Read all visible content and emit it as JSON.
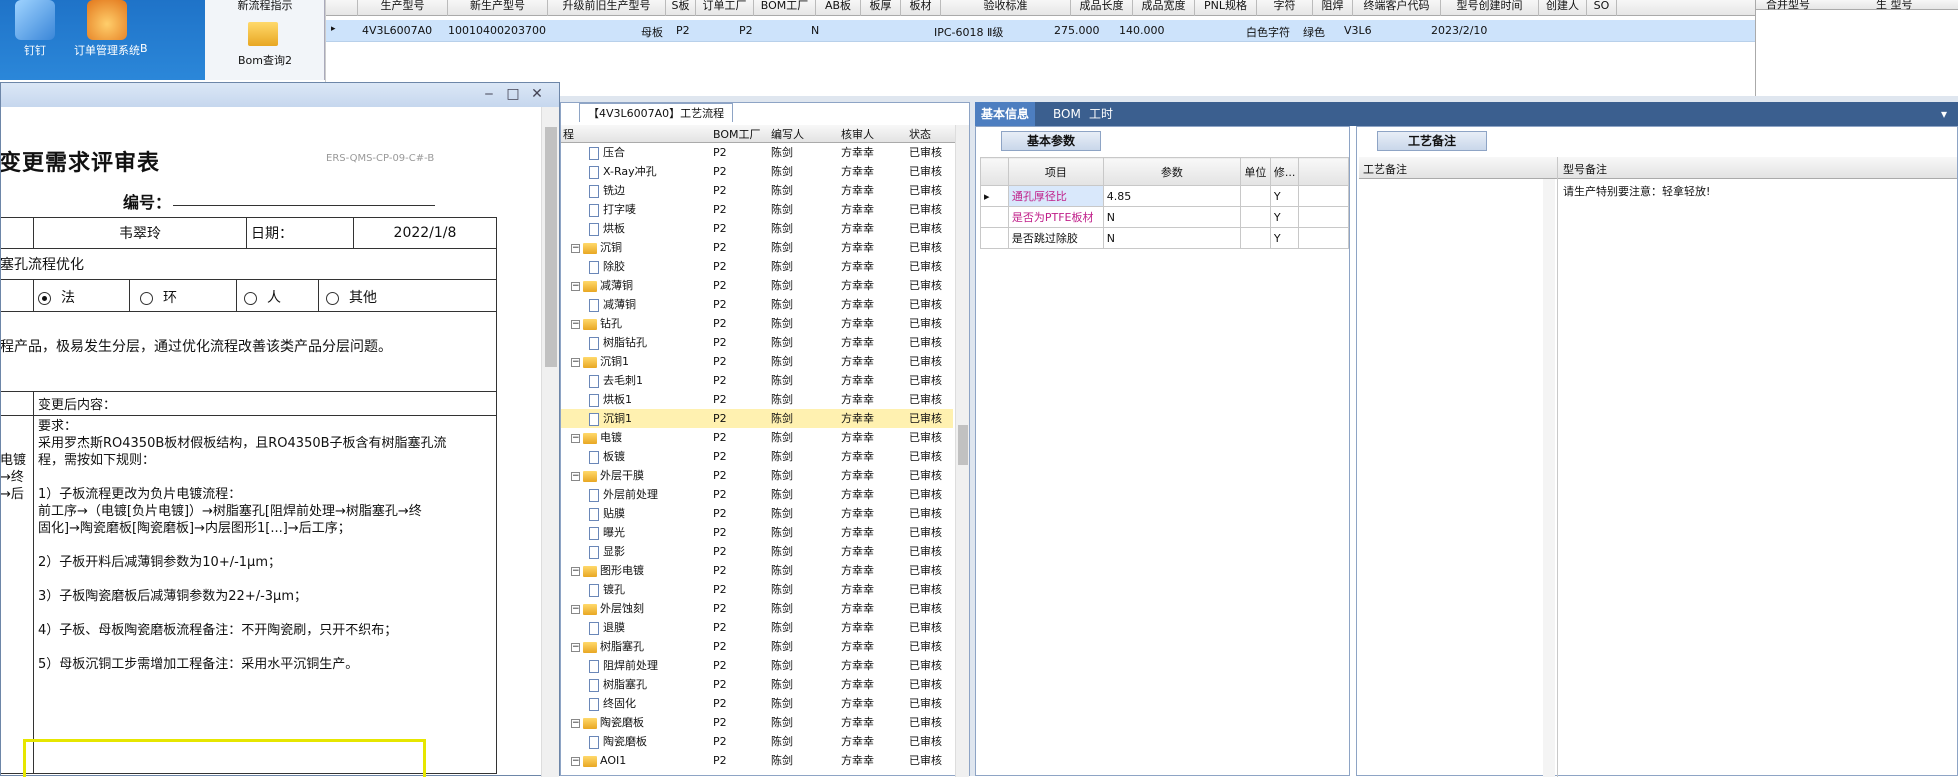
{
  "desktop": {
    "icon1_label": "钉钉",
    "icon2_label": "订单管理系统",
    "icon3_letter": "B"
  },
  "nav": {
    "item1": "新流程指示",
    "item2": "Bom查询2"
  },
  "top_grid": {
    "columns": [
      "生产型号",
      "新生产型号",
      "升级前旧生产型号",
      "S板",
      "订单工厂",
      "BOM工厂",
      "AB板",
      "板厚",
      "板材",
      "验收标准",
      "成品长度",
      "成品宽度",
      "PNL规格",
      "字符",
      "阻焊",
      "终端客户代码",
      "型号创建时间",
      "创建人",
      "SO"
    ],
    "row": {
      "model": "4V3L6007A0",
      "new_model": "10010400203700",
      "s_board": "母板",
      "order_factory": "P2",
      "bom_factory": "P2",
      "ab": "N",
      "accept": "IPC-6018 Ⅱ级",
      "length": "275.000",
      "width": "140.000",
      "char": "白色字符",
      "mask": "绿色",
      "customer": "V3L6",
      "created": "2023/2/10"
    }
  },
  "right_panel": {
    "col1": "合并型号",
    "col2": "生 型号"
  },
  "doc": {
    "title": "变更需求评审表",
    "code": "ERS-QMS-CP-09-C#-B",
    "num_label": "编号：",
    "applicant": "韦翠玲",
    "date_label": "日期：",
    "date_value": "2022/1/8",
    "subject": "塞孔流程优化",
    "opt1": "法",
    "opt2": "环",
    "opt3": "人",
    "opt4": "其他",
    "problem": "程产品，极易发生分层，通过优化流程改善该类产品分层问题。",
    "after_label": "变更后内容：",
    "req_label": "要求：",
    "line1": "采用罗杰斯RO4350B板材假板结构，且RO4350B子板含有树脂塞孔流",
    "line2": "程，需按如下规则：",
    "left_frag1": "电镀",
    "left_frag2": "→终",
    "left_frag3": "→后",
    "rule1a": "1）子板流程更改为负片电镀流程：",
    "rule1b": "前工序→（电镀[负片电镀]）→树脂塞孔[阻焊前处理→树脂塞孔→终",
    "rule1c": "固化]→陶瓷磨板[陶瓷磨板]→内层图形1[...]→后工序；",
    "rule2": "2）子板开料后减薄铜参数为10+/-1μm；",
    "rule3": "3）子板陶瓷磨板后减薄铜参数为22+/-3μm；",
    "rule4": "4）子板、母板陶瓷磨板流程备注：不开陶瓷刷，只开不织布；",
    "rule5": "5）母板沉铜工步需增加工程备注：采用水平沉铜生产。"
  },
  "process": {
    "tab": "【4V3L6007A0】工艺流程",
    "headers": [
      "程",
      "BOM工厂",
      "编写人",
      "核审人",
      "状态"
    ],
    "rows": [
      {
        "name": "压合",
        "lvl": 1,
        "folder": false
      },
      {
        "name": "X-Ray冲孔",
        "lvl": 1,
        "folder": false
      },
      {
        "name": "铣边",
        "lvl": 1,
        "folder": false
      },
      {
        "name": "打字唛",
        "lvl": 1,
        "folder": false
      },
      {
        "name": "烘板",
        "lvl": 1,
        "folder": false
      },
      {
        "name": "沉铜",
        "lvl": 0,
        "folder": true
      },
      {
        "name": "除胶",
        "lvl": 1,
        "folder": false
      },
      {
        "name": "减薄铜",
        "lvl": 0,
        "folder": true
      },
      {
        "name": "减薄铜",
        "lvl": 1,
        "folder": false
      },
      {
        "name": "钻孔",
        "lvl": 0,
        "folder": true
      },
      {
        "name": "树脂钻孔",
        "lvl": 1,
        "folder": false
      },
      {
        "name": "沉铜1",
        "lvl": 0,
        "folder": true
      },
      {
        "name": "去毛刺1",
        "lvl": 1,
        "folder": false
      },
      {
        "name": "烘板1",
        "lvl": 1,
        "folder": false
      },
      {
        "name": "沉铜1",
        "lvl": 1,
        "folder": false,
        "selected": true
      },
      {
        "name": "电镀",
        "lvl": 0,
        "folder": true
      },
      {
        "name": "板镀",
        "lvl": 1,
        "folder": false
      },
      {
        "name": "外层干膜",
        "lvl": 0,
        "folder": true
      },
      {
        "name": "外层前处理",
        "lvl": 1,
        "folder": false
      },
      {
        "name": "贴膜",
        "lvl": 1,
        "folder": false
      },
      {
        "name": "曝光",
        "lvl": 1,
        "folder": false
      },
      {
        "name": "显影",
        "lvl": 1,
        "folder": false
      },
      {
        "name": "图形电镀",
        "lvl": 0,
        "folder": true
      },
      {
        "name": "镀孔",
        "lvl": 1,
        "folder": false
      },
      {
        "name": "外层蚀刻",
        "lvl": 0,
        "folder": true
      },
      {
        "name": "退膜",
        "lvl": 1,
        "folder": false
      },
      {
        "name": "树脂塞孔",
        "lvl": 0,
        "folder": true
      },
      {
        "name": "阻焊前处理",
        "lvl": 1,
        "folder": false
      },
      {
        "name": "树脂塞孔",
        "lvl": 1,
        "folder": false
      },
      {
        "name": "终固化",
        "lvl": 1,
        "folder": false
      },
      {
        "name": "陶瓷磨板",
        "lvl": 0,
        "folder": true
      },
      {
        "name": "陶瓷磨板",
        "lvl": 1,
        "folder": false
      },
      {
        "name": "AOI1",
        "lvl": 0,
        "folder": true
      }
    ],
    "bom_factory": "P2",
    "author": "陈剑",
    "reviewer": "方幸幸",
    "status": "已审核"
  },
  "info_tabs": [
    "基本信息",
    "BOM",
    "工时"
  ],
  "basic": {
    "caption": "基本参数",
    "headers": [
      "项目",
      "参数",
      "单位",
      "修..."
    ],
    "rows": [
      {
        "item": "通孔厚径比",
        "value": "4.85",
        "flag": "Y"
      },
      {
        "item": "是否为PTFE板材",
        "value": "N",
        "flag": "Y"
      },
      {
        "item": "是否跳过除胶",
        "value": "N",
        "flag": "Y"
      }
    ]
  },
  "craft": {
    "caption": "工艺备注",
    "col1": "工艺备注",
    "col2": "型号备注",
    "note": "请生产特别要注意：轻拿轻放!"
  },
  "colors": {
    "accent": "#3b5f8f",
    "selected_row": "#cde3fb",
    "highlight": "#e6e600"
  }
}
